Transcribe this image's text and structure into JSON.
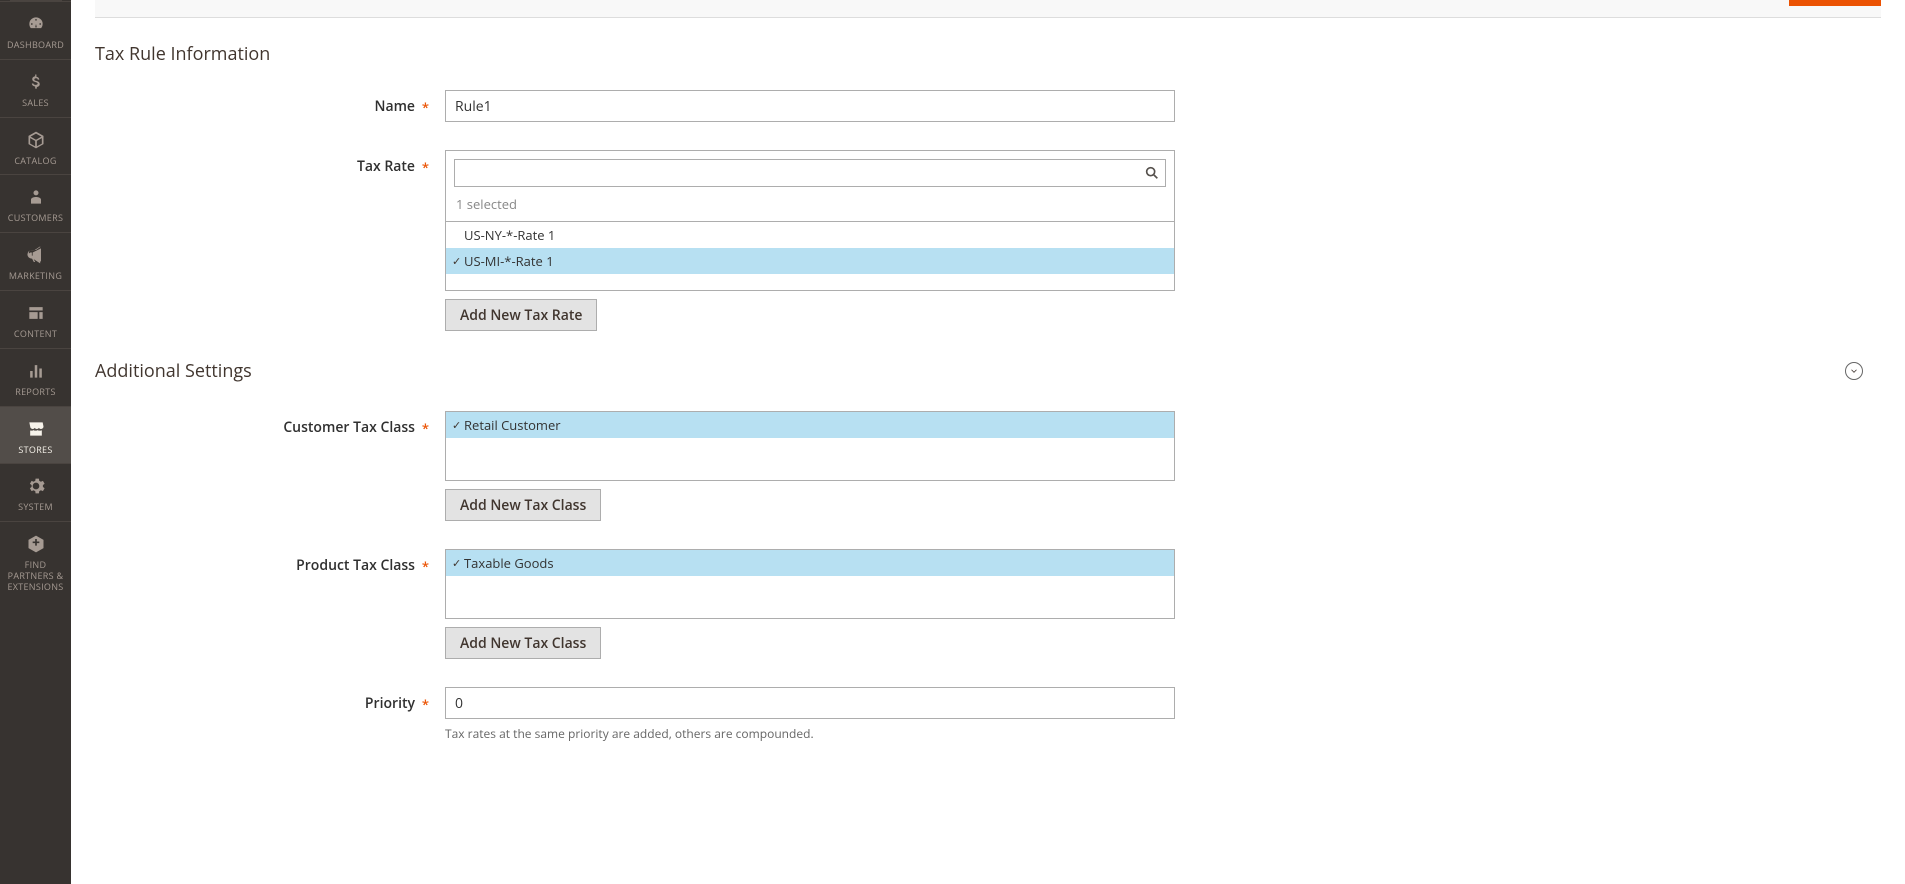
{
  "sidebar": {
    "items": [
      {
        "label": "DASHBOARD",
        "icon": "gauge"
      },
      {
        "label": "SALES",
        "icon": "dollar"
      },
      {
        "label": "CATALOG",
        "icon": "cube"
      },
      {
        "label": "CUSTOMERS",
        "icon": "person"
      },
      {
        "label": "MARKETING",
        "icon": "megaphone"
      },
      {
        "label": "CONTENT",
        "icon": "blocks"
      },
      {
        "label": "REPORTS",
        "icon": "bars"
      },
      {
        "label": "STORES",
        "icon": "storefront"
      },
      {
        "label": "SYSTEM",
        "icon": "gear"
      },
      {
        "label": "FIND PARTNERS & EXTENSIONS",
        "icon": "extension"
      }
    ],
    "active_index": 7
  },
  "section1_title": "Tax Rule Information",
  "section2_title": "Additional Settings",
  "fields": {
    "name": {
      "label": "Name",
      "value": "Rule1",
      "required": true
    },
    "tax_rate": {
      "label": "Tax Rate",
      "required": true,
      "selected_count_text": "1 selected",
      "options": [
        {
          "label": "US-NY-*-Rate 1",
          "selected": false
        },
        {
          "label": "US-MI-*-Rate 1",
          "selected": true
        }
      ],
      "add_button": "Add New Tax Rate"
    },
    "customer_tax_class": {
      "label": "Customer Tax Class",
      "required": true,
      "options": [
        {
          "label": "Retail Customer",
          "selected": true
        }
      ],
      "add_button": "Add New Tax Class"
    },
    "product_tax_class": {
      "label": "Product Tax Class",
      "required": true,
      "options": [
        {
          "label": "Taxable Goods",
          "selected": true
        }
      ],
      "add_button": "Add New Tax Class"
    },
    "priority": {
      "label": "Priority",
      "required": true,
      "value": "0",
      "help": "Tax rates at the same priority are added, others are compounded."
    }
  }
}
